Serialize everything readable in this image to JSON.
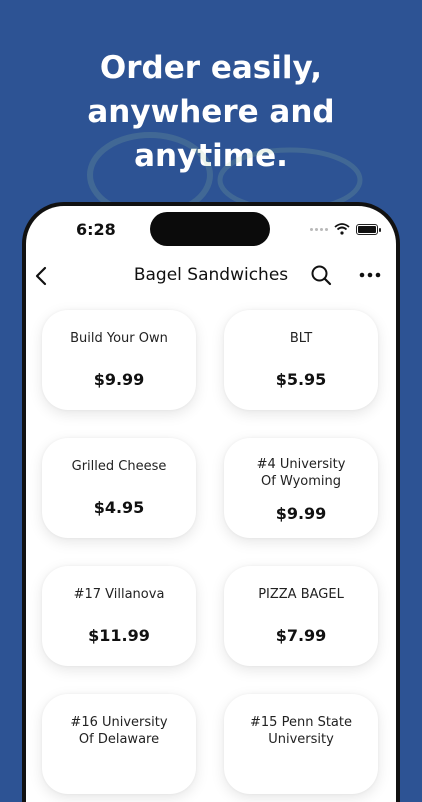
{
  "promo": {
    "headline_line1": "Order easily,",
    "headline_line2": "anywhere and",
    "headline_line3": "anytime."
  },
  "status_bar": {
    "time": "6:28"
  },
  "nav": {
    "title": "Bagel Sandwiches",
    "back_icon": "chevron-left-icon",
    "search_icon": "search-icon",
    "more_icon": "more-horizontal-icon"
  },
  "menu_items": [
    {
      "name": "Build Your Own",
      "price": "$9.99"
    },
    {
      "name": "BLT",
      "price": "$5.95"
    },
    {
      "name": "Grilled Cheese",
      "price": "$4.95"
    },
    {
      "name": "#4 University Of Wyoming",
      "price": "$9.99"
    },
    {
      "name": "#17 Villanova",
      "price": "$11.99"
    },
    {
      "name": "PIZZA BAGEL",
      "price": "$7.99"
    },
    {
      "name": "#16 University Of Delaware",
      "price": ""
    },
    {
      "name": "#15 Penn State University",
      "price": ""
    }
  ],
  "colors": {
    "background": "#2d5394",
    "card": "#ffffff",
    "text": "#111111"
  }
}
